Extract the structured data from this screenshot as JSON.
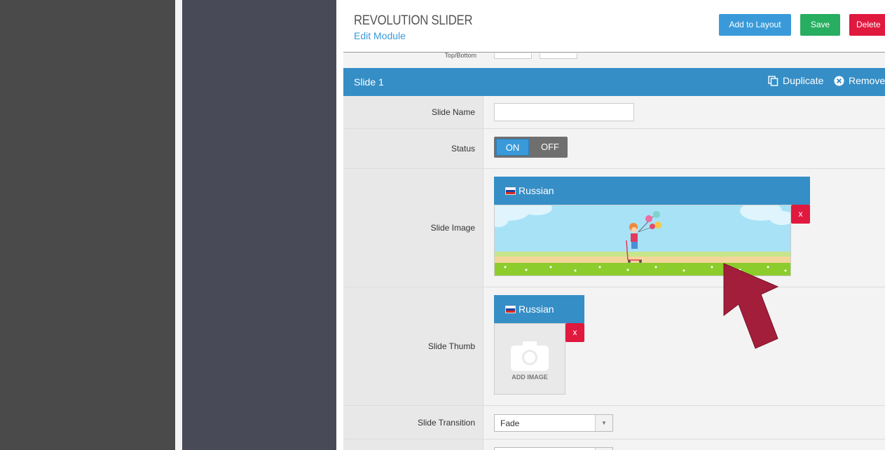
{
  "header": {
    "title": "REVOLUTION SLIDER",
    "subtitle": "Edit Module",
    "buttons": {
      "add": "Add to Layout",
      "save": "Save",
      "delete": "Delete"
    }
  },
  "partial_row": {
    "label": "Top/Bottom"
  },
  "slide": {
    "name": "Slide 1",
    "duplicate": "Duplicate",
    "remove": "Remove"
  },
  "fields": {
    "slide_name": {
      "label": "Slide Name",
      "value": ""
    },
    "status": {
      "label": "Status",
      "on": "ON",
      "off": "OFF",
      "selected": "ON"
    },
    "slide_image": {
      "label": "Slide Image",
      "language": "Russian",
      "remove": "x"
    },
    "slide_thumb": {
      "label": "Slide Thumb",
      "language": "Russian",
      "remove": "x",
      "placeholder": "ADD IMAGE"
    },
    "slide_transition": {
      "label": "Slide Transition",
      "value": "Fade"
    }
  },
  "icons": {
    "duplicate": "copy-icon",
    "remove": "close-circle-icon",
    "arrow": "pointer-arrow-icon",
    "camera": "camera-icon"
  },
  "colors": {
    "primary": "#358ec6",
    "success": "#27ae60",
    "danger": "#e0193f",
    "annotation_arrow": "#a31e3a"
  }
}
